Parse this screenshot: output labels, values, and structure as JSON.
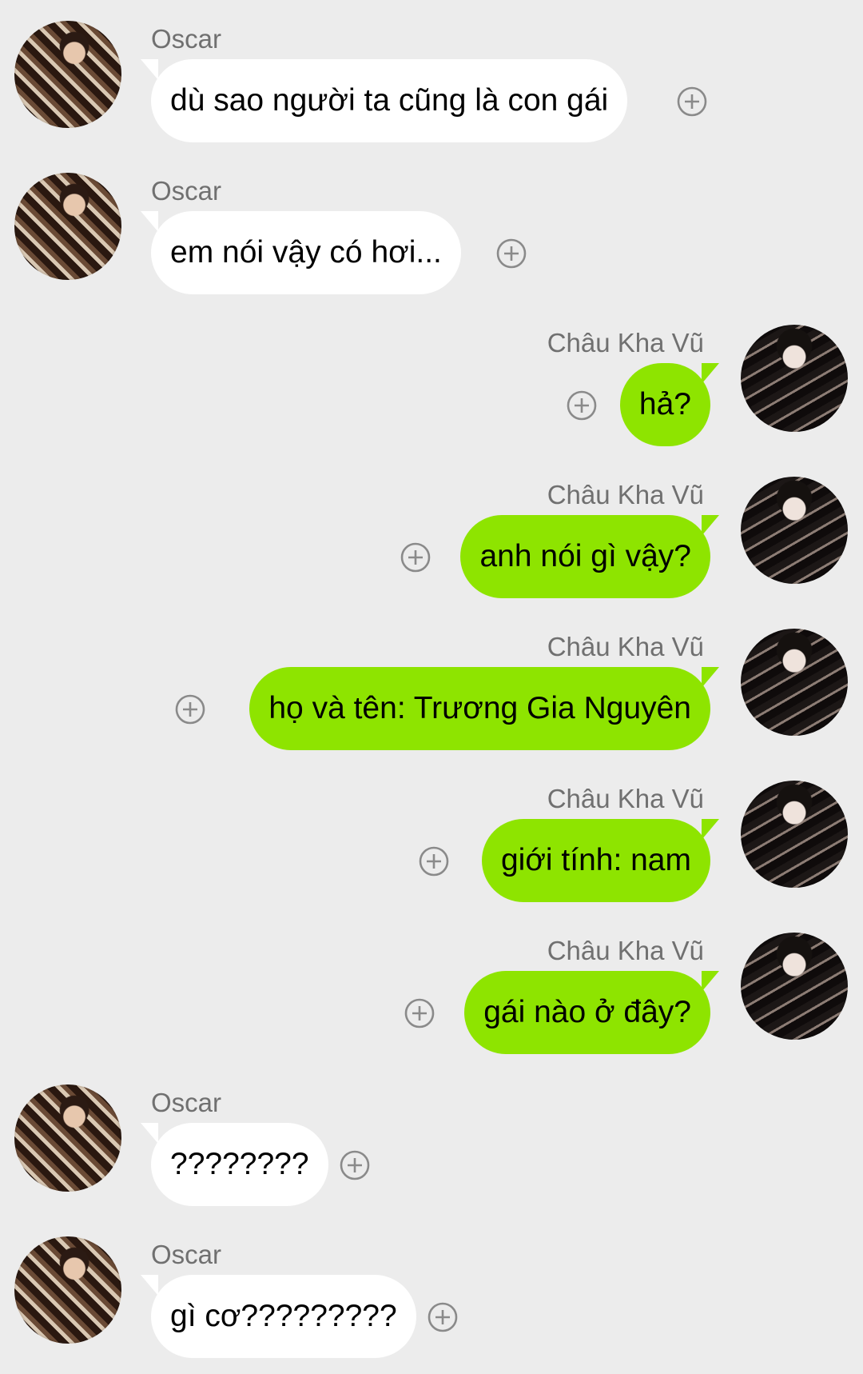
{
  "messages": [
    {
      "sender": "Oscar",
      "side": "left",
      "text": "dù sao người ta cũng là con gái"
    },
    {
      "sender": "Oscar",
      "side": "left",
      "text": "em nói vậy có hơi..."
    },
    {
      "sender": "Châu Kha Vũ",
      "side": "right",
      "text": "hả?"
    },
    {
      "sender": "Châu Kha Vũ",
      "side": "right",
      "text": "anh nói gì vậy?"
    },
    {
      "sender": "Châu Kha Vũ",
      "side": "right",
      "text": "họ và tên: Trương Gia Nguyên"
    },
    {
      "sender": "Châu Kha Vũ",
      "side": "right",
      "text": "giới tính: nam"
    },
    {
      "sender": "Châu Kha Vũ",
      "side": "right",
      "text": "gái nào ở đây?"
    },
    {
      "sender": "Oscar",
      "side": "left",
      "text": "????????"
    },
    {
      "sender": "Oscar",
      "side": "left",
      "text": "gì cơ?????????"
    }
  ],
  "icons": {
    "reaction": "plus-circle-icon",
    "avatar_left": "oscar-avatar",
    "avatar_right": "chau-kha-vu-avatar"
  },
  "colors": {
    "background": "#ececec",
    "incoming_bubble": "#ffffff",
    "outgoing_bubble": "#8ee400",
    "sender_name": "#707070",
    "icon": "#8a8a8a"
  }
}
